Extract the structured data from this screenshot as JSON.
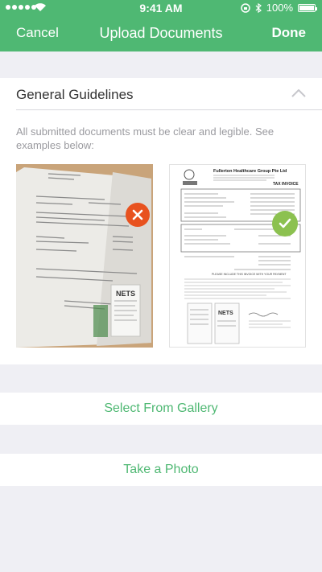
{
  "status_bar": {
    "time": "9:41 AM",
    "battery": "100%"
  },
  "nav": {
    "cancel_label": "Cancel",
    "title": "Upload Documents",
    "done_label": "Done"
  },
  "guidelines": {
    "title": "General Guidelines",
    "description": "All submitted documents must be clear and legible. See examples below:",
    "examples": [
      {
        "kind": "bad",
        "icon": "close-icon",
        "color": "#e8521f"
      },
      {
        "kind": "good",
        "icon": "check-icon",
        "color": "#8cc150"
      }
    ],
    "sample_invoice": {
      "company": "Fullerton Healthcare Group Pte Ltd",
      "doc_type": "TAX INVOICE",
      "footer": "PLEASE INCLUDE THIS INVOICE WITH YOUR PAYMENT",
      "receipt_brand": "NETS"
    }
  },
  "actions": {
    "gallery_label": "Select From Gallery",
    "photo_label": "Take a Photo"
  },
  "colors": {
    "brand": "#4fb873",
    "background": "#efeff4"
  }
}
